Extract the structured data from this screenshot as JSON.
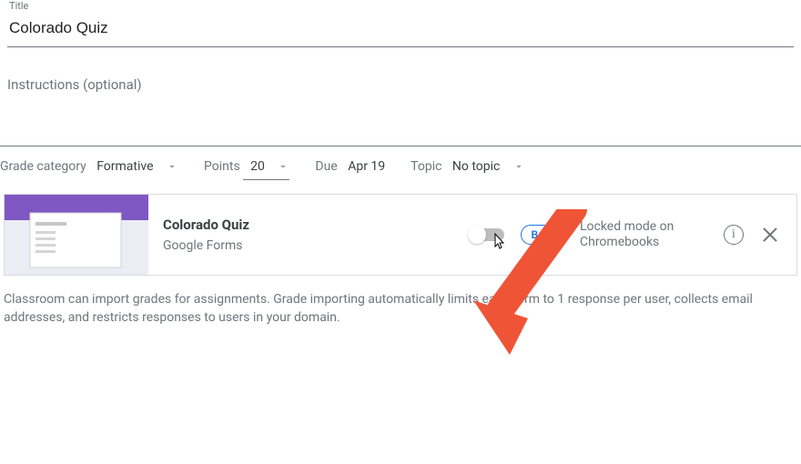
{
  "title_field": {
    "label": "Title",
    "value": "Colorado Quiz"
  },
  "instructions": {
    "placeholder": "Instructions (optional)"
  },
  "options": {
    "grade_category": {
      "label": "Grade category",
      "value": "Formative"
    },
    "points": {
      "label": "Points",
      "value": "20"
    },
    "due": {
      "label": "Due",
      "value": "Apr 19"
    },
    "topic": {
      "label": "Topic",
      "value": "No topic"
    }
  },
  "attachment": {
    "title": "Colorado Quiz",
    "source": "Google Forms",
    "locked_mode": {
      "toggle_on": false,
      "beta_label": "Beta",
      "label": "Locked mode on Chromebooks"
    }
  },
  "footer_help": "Classroom can import grades for assignments. Grade importing automatically limits each form to 1 response per user, collects email addresses, and restricts responses to users in your domain."
}
